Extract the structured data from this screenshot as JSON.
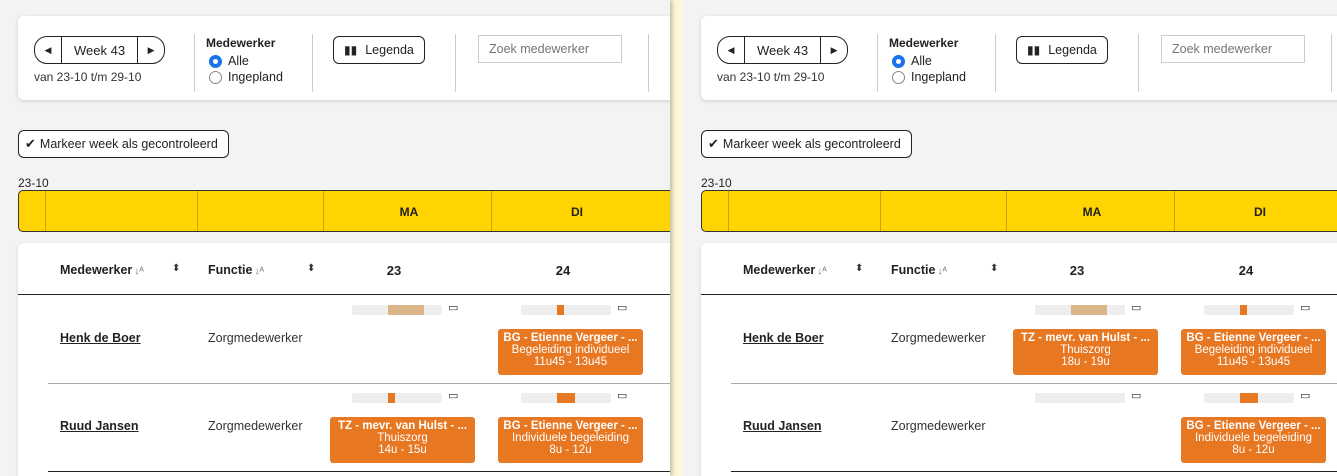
{
  "toolbar": {
    "prev_icon": "chevron-left-icon",
    "week_label": "Week 43",
    "next_icon": "chevron-right-icon",
    "range": "van 23-10 t/m 29-10",
    "employee_title": "Medewerker",
    "radio_all": "Alle",
    "radio_planned": "Ingepland",
    "legend_icon": "book-icon",
    "legend_label": "Legenda",
    "search_placeholder": "Zoek medewerker"
  },
  "mark_week_label": "Markeer week als gecontroleerd",
  "date_label": "23-10",
  "days": [
    {
      "short": "MA",
      "num": "23"
    },
    {
      "short": "DI",
      "num": "24"
    }
  ],
  "columns": {
    "employee": "Medewerker",
    "function": "Functie"
  },
  "colors": {
    "accent_yellow": "#ffd400",
    "appointment_orange": "#e87722",
    "capacity_tan": "#dcb48a"
  },
  "panels": [
    {
      "rows": [
        {
          "name": "Henk de Boer",
          "function": "Zorgmedewerker",
          "capacity": [
            {
              "fill": 0.4,
              "color": "#dcb48a"
            },
            {
              "fill": 0.08,
              "color": "#e87722"
            }
          ],
          "appointments": [
            null,
            {
              "title": "BG - Etienne Vergeer - ...",
              "desc": "Begeleiding individueel",
              "time": "11u45 - 13u45"
            }
          ]
        },
        {
          "name": "Ruud Jansen",
          "function": "Zorgmedewerker",
          "capacity": [
            {
              "fill": 0.08,
              "color": "#e87722"
            },
            {
              "fill": 0.2,
              "color": "#e87722"
            }
          ],
          "appointments": [
            {
              "title": "TZ - mevr. van Hulst - ...",
              "desc": "Thuiszorg",
              "time": "14u - 15u"
            },
            {
              "title": "BG - Etienne Vergeer - ...",
              "desc": "Individuele begeleiding",
              "time": "8u - 12u"
            }
          ]
        }
      ]
    },
    {
      "rows": [
        {
          "name": "Henk de Boer",
          "function": "Zorgmedewerker",
          "capacity": [
            {
              "fill": 0.4,
              "color": "#dcb48a"
            },
            {
              "fill": 0.08,
              "color": "#e87722"
            }
          ],
          "appointments": [
            {
              "title": "TZ - mevr. van Hulst - ...",
              "desc": "Thuiszorg",
              "time": "18u - 19u"
            },
            {
              "title": "BG - Etienne Vergeer - ...",
              "desc": "Begeleiding individueel",
              "time": "11u45 - 13u45"
            }
          ]
        },
        {
          "name": "Ruud Jansen",
          "function": "Zorgmedewerker",
          "capacity": [
            {
              "fill": 0.0,
              "color": "#e87722"
            },
            {
              "fill": 0.2,
              "color": "#e87722"
            }
          ],
          "appointments": [
            null,
            {
              "title": "BG - Etienne Vergeer - ...",
              "desc": "Individuele begeleiding",
              "time": "8u - 12u"
            }
          ]
        }
      ]
    }
  ]
}
